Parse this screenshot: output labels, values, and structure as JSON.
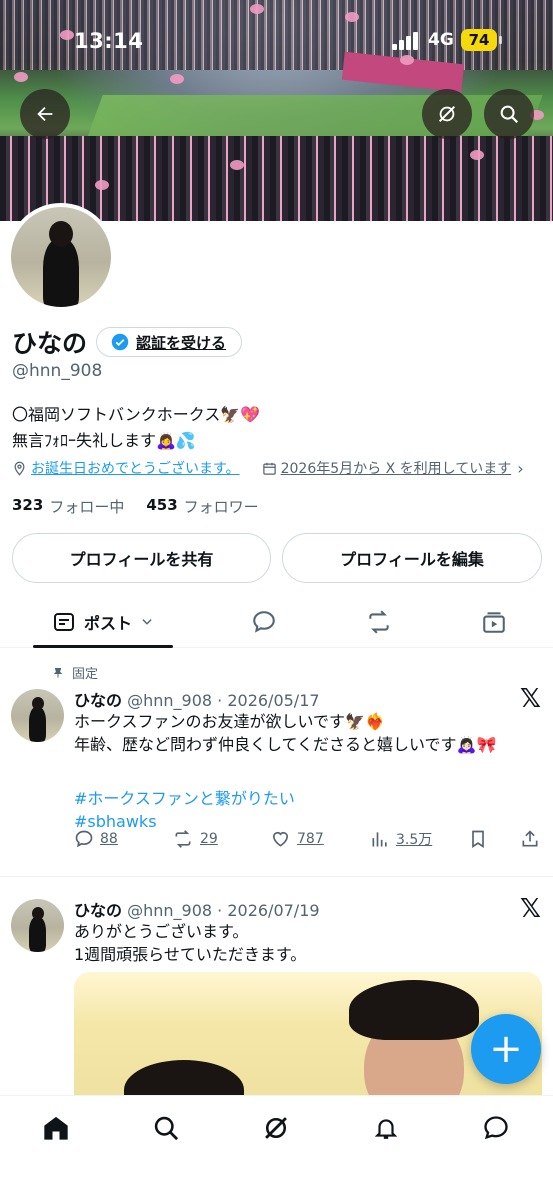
{
  "status_bar": {
    "time": "13:14",
    "network": "4G",
    "battery": "74"
  },
  "profile": {
    "display_name": "ひなの",
    "verify_label": "認証を受ける",
    "handle": "@hnn_908",
    "bio_line1": "〇福岡ソフトバンクホークス🦅💖",
    "bio_line2": "無言ﾌｫﾛｰ失礼します🙇‍♀️💦",
    "birthday_text": "お誕生日おめでとうございます。",
    "joined_text": "2026年5月から X を利用しています",
    "following_count": "323",
    "following_label": "フォロー中",
    "followers_count": "453",
    "followers_label": "フォロワー",
    "share_label": "プロフィールを共有",
    "edit_label": "プロフィールを編集"
  },
  "tabs": {
    "posts_label": "ポスト"
  },
  "posts": [
    {
      "pinned_label": "固定",
      "name": "ひなの",
      "handle_date": "@hnn_908 · 2026/05/17",
      "line1": "ホークスファンのお友達が欲しいです🦅❤️‍🔥",
      "line2": "年齢、歴など問わず仲良くしてくださると嬉しいです🙇🏻‍♀️🎀",
      "hashtag1": "#ホークスファンと繋がりたい",
      "hashtag2": "#sbhawks",
      "replies": "88",
      "reposts": "29",
      "likes": "787",
      "views": "3.5万"
    },
    {
      "name": "ひなの",
      "handle_date": "@hnn_908 · 2026/07/19",
      "line1": "ありがとうございます。",
      "line2": "1週間頑張らせていただきます。"
    }
  ],
  "x_logo": "𝕏",
  "fab_label": "+"
}
